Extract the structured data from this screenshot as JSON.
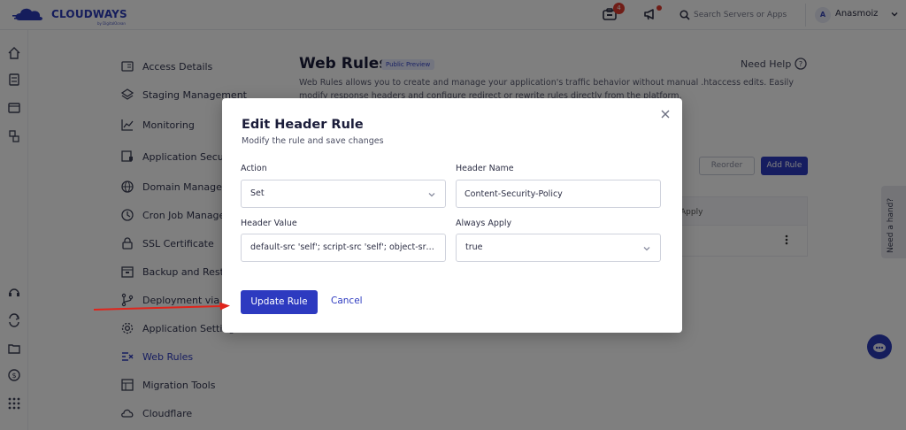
{
  "brand": {
    "name": "CLOUDWAYS",
    "sub": "by DigitalOcean",
    "color": "#2b3bb8"
  },
  "topbar": {
    "notification_count": "4",
    "search_placeholder": "Search Servers or Apps",
    "user_initial": "A",
    "username": "Anasmoiz"
  },
  "sidebar": {
    "items": [
      {
        "label": "Access Details",
        "icon": "id-card-icon"
      },
      {
        "label": "Staging Management",
        "icon": "layers-icon"
      },
      {
        "label": "Monitoring",
        "icon": "chart-line-icon"
      },
      {
        "label": "Application Security",
        "icon": "shield-window-icon"
      },
      {
        "label": "Domain Management",
        "icon": "globe-icon"
      },
      {
        "label": "Cron Job Management",
        "icon": "clock-history-icon"
      },
      {
        "label": "SSL Certificate",
        "icon": "lock-icon"
      },
      {
        "label": "Backup and Restore",
        "icon": "backup-icon"
      },
      {
        "label": "Deployment via Git",
        "icon": "git-branch-icon"
      },
      {
        "label": "Application Settings",
        "icon": "gear-icon"
      },
      {
        "label": "Web Rules",
        "icon": "rules-icon",
        "active": true
      },
      {
        "label": "Migration Tools",
        "icon": "migration-icon"
      },
      {
        "label": "Cloudflare",
        "icon": "cloud-icon"
      }
    ]
  },
  "page": {
    "title": "Web Rules",
    "badge": "Public Preview",
    "need_help": "Need Help",
    "description": "Web Rules allows you to create and manage your application's traffic behavior without manual .htaccess edits. Easily modify response headers and configure redirect or rewrite rules directly from the platform.",
    "secondary_button": "Reorder",
    "add_button": "Add Rule",
    "table_header_apply": "Apply",
    "help_tab": "Need a hand?"
  },
  "modal": {
    "title": "Edit Header Rule",
    "subtitle": "Modify the rule and save changes",
    "action": {
      "label": "Action",
      "value": "Set"
    },
    "header_name": {
      "label": "Header Name",
      "value": "Content-Security-Policy"
    },
    "header_value": {
      "label": "Header Value",
      "value": "default-src 'self'; script-src 'self'; object-src '..."
    },
    "always_apply": {
      "label": "Always Apply",
      "value": "true"
    },
    "update_button": "Update Rule",
    "cancel_button": "Cancel"
  },
  "colors": {
    "accent": "#2d3ac0",
    "annotation_arrow": "#e0241b",
    "badge": "#e03b2f"
  }
}
